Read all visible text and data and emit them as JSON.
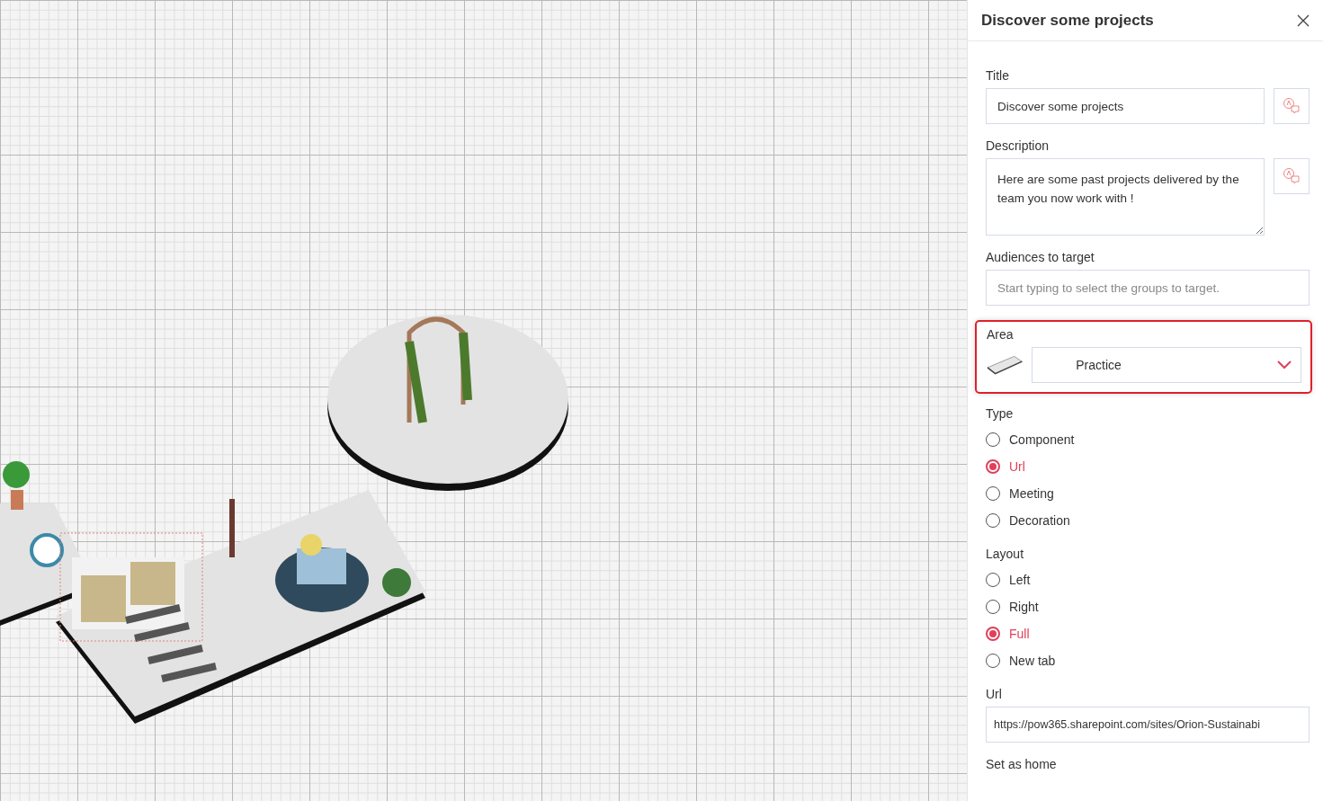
{
  "panel": {
    "title": "Discover some projects",
    "title_field": {
      "label": "Title",
      "value": "Discover some projects"
    },
    "description_field": {
      "label": "Description",
      "value": "Here are some past projects delivered by the team you now work with !"
    },
    "audiences_field": {
      "label": "Audiences to target",
      "placeholder": "Start typing to select the groups to target."
    },
    "area_field": {
      "label": "Area",
      "value": "Practice",
      "highlighted": true
    },
    "type_group": {
      "label": "Type",
      "options": [
        {
          "label": "Component",
          "selected": false
        },
        {
          "label": "Url",
          "selected": true
        },
        {
          "label": "Meeting",
          "selected": false
        },
        {
          "label": "Decoration",
          "selected": false
        }
      ]
    },
    "layout_group": {
      "label": "Layout",
      "options": [
        {
          "label": "Left",
          "selected": false
        },
        {
          "label": "Right",
          "selected": false
        },
        {
          "label": "Full",
          "selected": true
        },
        {
          "label": "New tab",
          "selected": false
        }
      ]
    },
    "url_field": {
      "label": "Url",
      "value": "https://pow365.sharepoint.com/sites/Orion-Sustainabi"
    },
    "set_as_home": {
      "label": "Set as home"
    }
  }
}
